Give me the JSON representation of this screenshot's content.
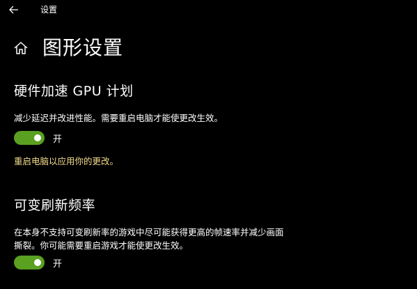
{
  "window": {
    "app_title": "设置",
    "back_icon": "back-arrow-icon"
  },
  "header": {
    "home_icon": "home-icon",
    "page_title": "图形设置"
  },
  "hardware_gpu_scheduling": {
    "title": "硬件加速 GPU 计划",
    "description": "减少延迟并改进性能。需要重启电脑才能使更改生效。",
    "toggle_on": true,
    "toggle_label": "开",
    "restart_notice": "重启电脑以应用你的更改。"
  },
  "variable_refresh_rate": {
    "title": "可变刷新频率",
    "description_line1": "在本身不支持可变刷新率的游戏中尽可能获得更高的帧速率并减少画面",
    "description_line2": "撕裂。你可能需要重启游戏才能使更改生效。",
    "toggle_on": true,
    "toggle_label": "开"
  },
  "colors": {
    "background": "#000000",
    "toggle_on": "#5aa021",
    "notice_text": "#f5dd8c"
  }
}
